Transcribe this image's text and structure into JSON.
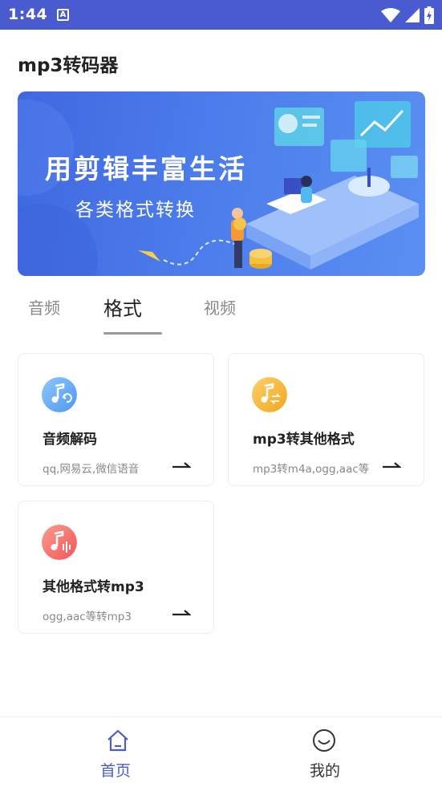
{
  "status_bar": {
    "time": "1:44",
    "indicator": "A"
  },
  "app": {
    "title": "mp3转码器"
  },
  "banner": {
    "headline": "用剪辑丰富生活",
    "subtitle": "各类格式转换"
  },
  "tabs": [
    {
      "label": "音频",
      "active": false
    },
    {
      "label": "格式",
      "active": true
    },
    {
      "label": "视频",
      "active": false
    }
  ],
  "cards": [
    {
      "title": "音频解码",
      "desc": "qq,网易云,微信语音",
      "icon": "music-convert-icon",
      "color": "#6aaef6"
    },
    {
      "title": "mp3转其他格式",
      "desc": "mp3转m4a,ogg,aac等",
      "icon": "music-swap-icon",
      "color": "#f7b940"
    },
    {
      "title": "其他格式转mp3",
      "desc": "ogg,aac等转mp3",
      "icon": "music-wave-icon",
      "color": "#f56b6b"
    }
  ],
  "bottom_nav": [
    {
      "label": "首页",
      "icon": "home-icon",
      "active": true
    },
    {
      "label": "我的",
      "icon": "smile-icon",
      "active": false
    }
  ],
  "colors": {
    "accent": "#4a5bd0",
    "status_bar": "#4a5bd0",
    "nav_active": "#4a5bd0",
    "nav_inactive": "#333333"
  }
}
